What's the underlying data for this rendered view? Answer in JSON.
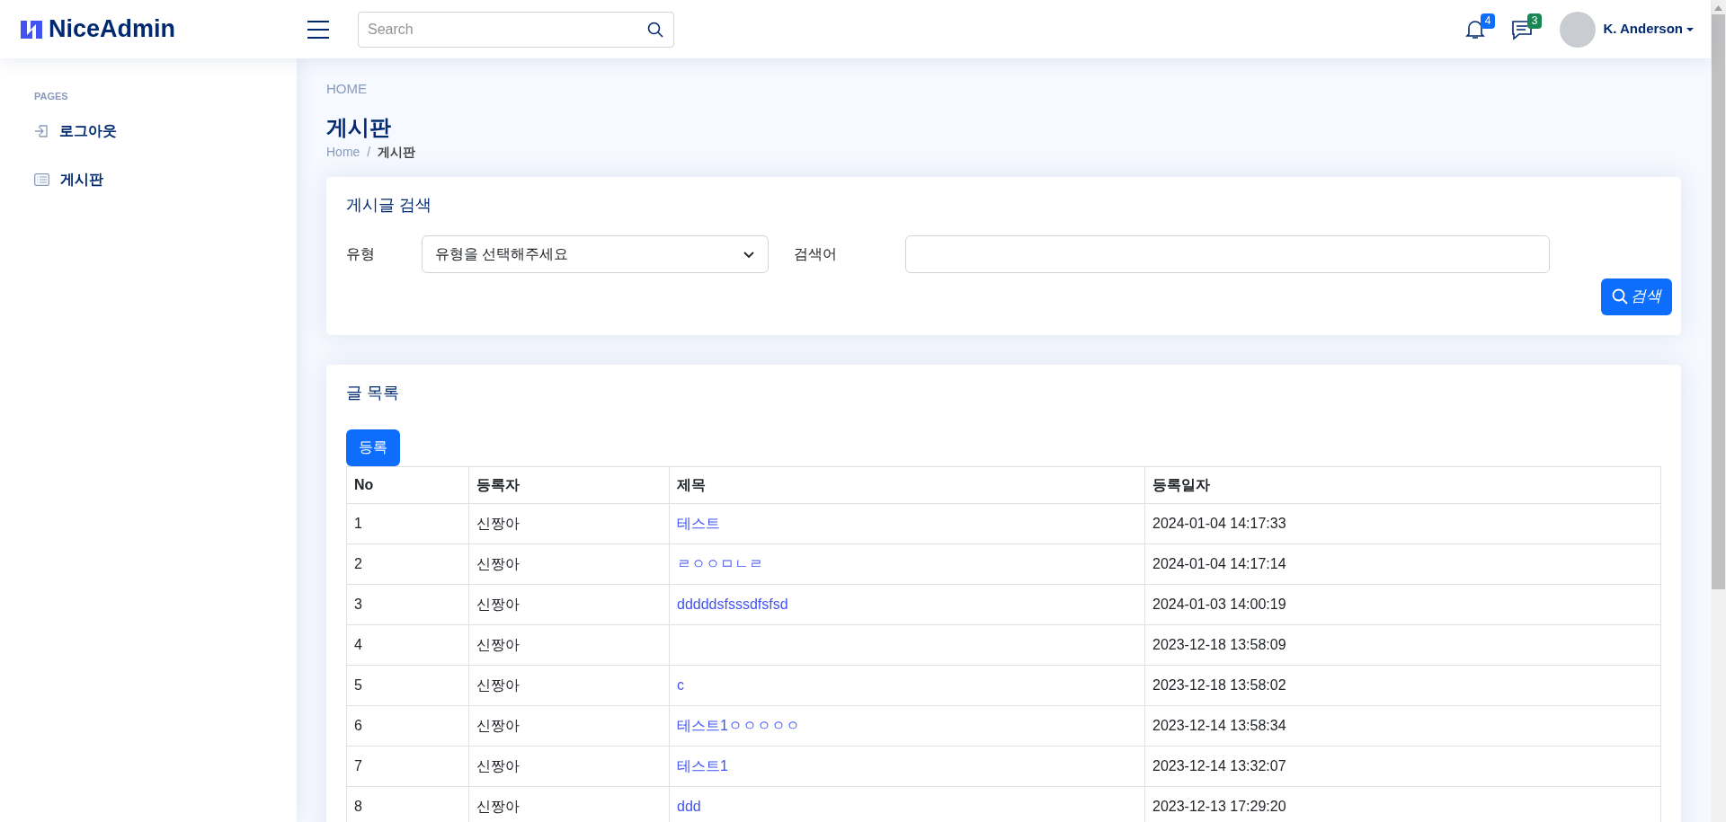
{
  "header": {
    "logo": "NiceAdmin",
    "search": {
      "placeholder": "Search"
    },
    "notifications": {
      "count": "4"
    },
    "messages": {
      "count": "3"
    },
    "user": {
      "name": "K. Anderson"
    }
  },
  "sidebar": {
    "heading": "PAGES",
    "items": [
      {
        "label": "로그아웃",
        "kind": "login"
      },
      {
        "label": "게시판",
        "kind": "list"
      }
    ]
  },
  "page": {
    "eyebrow": "HOME",
    "title": "게시판",
    "breadcrumb_separator": "/",
    "breadcrumb": [
      {
        "label": "Home"
      },
      {
        "label": "게시판"
      }
    ]
  },
  "search_card": {
    "title": "게시글 검색",
    "type_label": "유형",
    "type_select": {
      "value": "유형을 선택해주세요"
    },
    "keyword_label": "검색어",
    "search_button": "검색"
  },
  "list_card": {
    "title": "글 목록",
    "register_button": "등록",
    "table": {
      "columns": [
        "No",
        "등록자",
        "제목",
        "등록일자"
      ],
      "rows": [
        {
          "no": "1",
          "author": "신짱아",
          "title": "테스트",
          "date": "2024-01-04 14:17:33"
        },
        {
          "no": "2",
          "author": "신짱아",
          "title": "ㄹㅇㅇㅁㄴㄹ",
          "date": "2024-01-04 14:17:14"
        },
        {
          "no": "3",
          "author": "신짱아",
          "title": "dddddsfsssdfsfsd",
          "date": "2024-01-03 14:00:19"
        },
        {
          "no": "4",
          "author": "신짱아",
          "date": "2023-12-18 13:58:09"
        },
        {
          "no": "5",
          "author": "신짱아",
          "title": "c",
          "date": "2023-12-18 13:58:02"
        },
        {
          "no": "6",
          "author": "신짱아",
          "title": "테스트1ㅇㅇㅇㅇㅇ",
          "date": "2023-12-14 13:58:34"
        },
        {
          "no": "7",
          "author": "신짱아",
          "title": "테스트1",
          "date": "2023-12-14 13:32:07"
        },
        {
          "no": "8",
          "author": "신짱아",
          "title": "ddd",
          "date": "2023-12-13 17:29:20"
        }
      ]
    }
  }
}
